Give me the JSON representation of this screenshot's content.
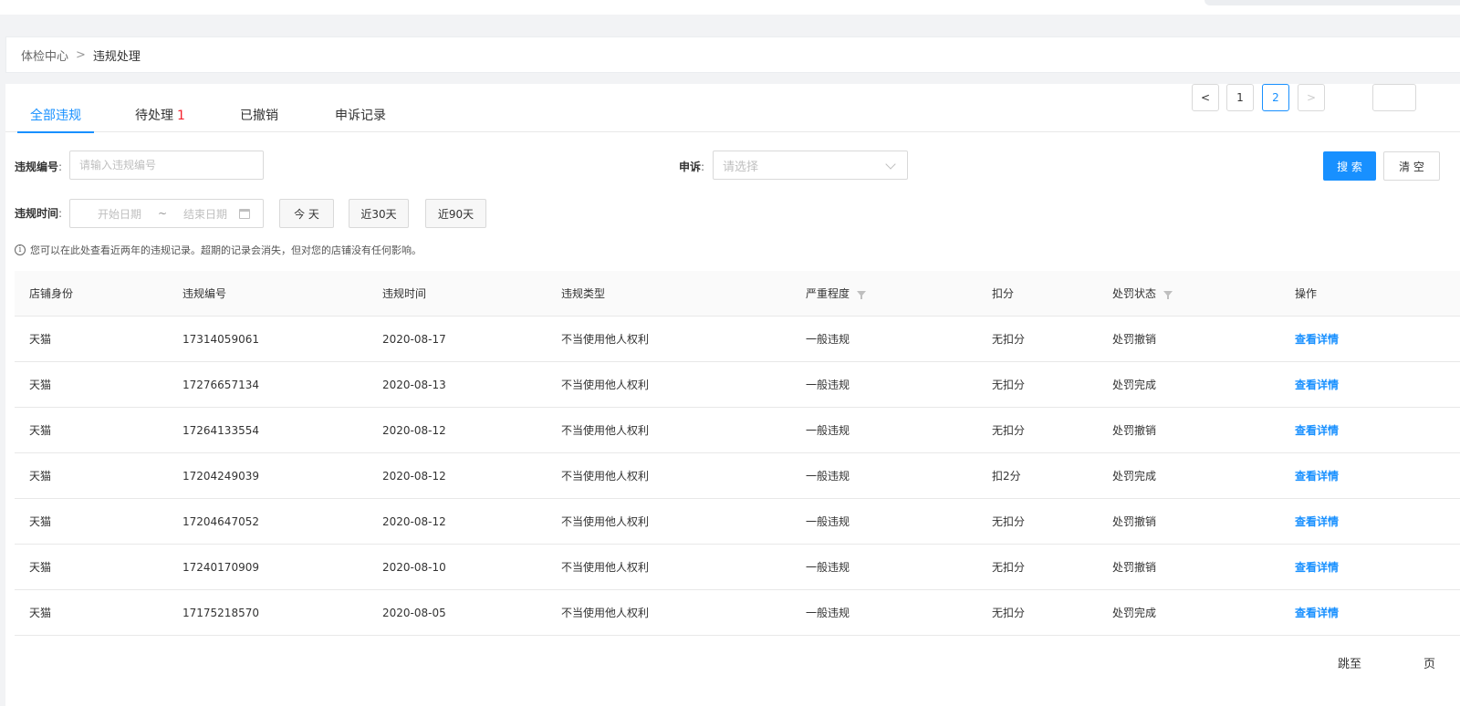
{
  "breadcrumb": {
    "root": "体检中心",
    "separator": ">",
    "current": "违规处理"
  },
  "tabs": [
    {
      "label": "全部违规",
      "active": true
    },
    {
      "label": "待处理",
      "badge": "1"
    },
    {
      "label": "已撤销"
    },
    {
      "label": "申诉记录"
    }
  ],
  "filters": {
    "violation_no_label": "违规编号",
    "violation_no_placeholder": "请输入违规编号",
    "appeal_label": "申诉",
    "appeal_placeholder": "请选择",
    "time_label": "违规时间",
    "start_placeholder": "开始日期",
    "range_sep": "~",
    "end_placeholder": "结束日期",
    "quick_today": "今 天",
    "quick_30": "近30天",
    "quick_90": "近90天",
    "search_button": "搜 索",
    "clear_button": "清 空"
  },
  "notice": "您可以在此处查看近两年的违规记录。超期的记录会消失，但对您的店铺没有任何影响。",
  "table": {
    "columns": [
      "店铺身份",
      "违规编号",
      "违规时间",
      "违规类型",
      "严重程度",
      "扣分",
      "处罚状态",
      "操作"
    ],
    "rows": [
      {
        "shop": "天猫",
        "no": "17314059061",
        "time": "2020-08-17",
        "type": "不当使用他人权利",
        "level": "一般违规",
        "points": "无扣分",
        "status": "处罚撤销",
        "action": "查看详情"
      },
      {
        "shop": "天猫",
        "no": "17276657134",
        "time": "2020-08-13",
        "type": "不当使用他人权利",
        "level": "一般违规",
        "points": "无扣分",
        "status": "处罚完成",
        "action": "查看详情"
      },
      {
        "shop": "天猫",
        "no": "17264133554",
        "time": "2020-08-12",
        "type": "不当使用他人权利",
        "level": "一般违规",
        "points": "无扣分",
        "status": "处罚撤销",
        "action": "查看详情"
      },
      {
        "shop": "天猫",
        "no": "17204249039",
        "time": "2020-08-12",
        "type": "不当使用他人权利",
        "level": "一般违规",
        "points": "扣2分",
        "status": "处罚完成",
        "action": "查看详情"
      },
      {
        "shop": "天猫",
        "no": "17204647052",
        "time": "2020-08-12",
        "type": "不当使用他人权利",
        "level": "一般违规",
        "points": "无扣分",
        "status": "处罚撤销",
        "action": "查看详情"
      },
      {
        "shop": "天猫",
        "no": "17240170909",
        "time": "2020-08-10",
        "type": "不当使用他人权利",
        "level": "一般违规",
        "points": "无扣分",
        "status": "处罚撤销",
        "action": "查看详情"
      },
      {
        "shop": "天猫",
        "no": "17175218570",
        "time": "2020-08-05",
        "type": "不当使用他人权利",
        "level": "一般违规",
        "points": "无扣分",
        "status": "处罚完成",
        "action": "查看详情"
      }
    ]
  },
  "pagination": {
    "prev": "<",
    "pages": [
      "1",
      "2"
    ],
    "current": "2",
    "next": ">",
    "jump_label": "跳至",
    "page_suffix": "页"
  },
  "colors": {
    "accent": "#1890ff",
    "badge": "#f5222d"
  }
}
